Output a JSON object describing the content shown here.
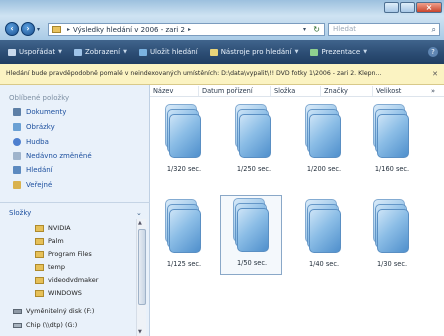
{
  "titlebar": {
    "address_path": "Výsledky hledání v 2006 - zari 2",
    "search_placeholder": "Hledat"
  },
  "toolbar": {
    "items": [
      {
        "label": "Uspořádat",
        "icon": "organize-icon",
        "color": "#c9d9ec"
      },
      {
        "label": "Zobrazení",
        "icon": "views-icon",
        "color": "#9ec3e8"
      },
      {
        "label": "Uložit hledání",
        "icon": "save-icon",
        "color": "#7ab2e0"
      },
      {
        "label": "Nástroje pro hledání",
        "icon": "search-tools-icon",
        "color": "#e8d47a"
      },
      {
        "label": "Prezentace",
        "icon": "slideshow-icon",
        "color": "#8fd08f"
      }
    ]
  },
  "infobar": {
    "text": "Hledání bude pravděpodobně pomalé v neindexovaných umístěních: D:\\data\\vypalit\\!! DVD fotky 1\\2006 - zari 2. Klepn..."
  },
  "leftpane": {
    "favorites_title": "Oblíbené položky",
    "favorites": [
      {
        "label": "Dokumenty",
        "color": "#5d7fa6"
      },
      {
        "label": "Obrázky",
        "color": "#6aa0d4"
      },
      {
        "label": "Hudba",
        "color": "#4d7fcf"
      },
      {
        "label": "Nedávno změněné",
        "color": "#9fb4cc"
      },
      {
        "label": "Hledání",
        "color": "#5c8ac0"
      },
      {
        "label": "Veřejné",
        "color": "#d9b24e"
      }
    ],
    "folders_title": "Složky",
    "folders": [
      "NVIDIA",
      "Palm",
      "Program Files",
      "temp",
      "videodvdmaker",
      "WINDOWS"
    ],
    "drives": [
      "Vyměnitelný disk (F:)",
      "Chip (\\\\dtp) (G:)"
    ]
  },
  "columns": [
    "Název",
    "Datum pořízení",
    "Složka",
    "Značky",
    "Velikost"
  ],
  "files": [
    {
      "label": "1/320 sec.",
      "selected": false
    },
    {
      "label": "1/250 sec.",
      "selected": false
    },
    {
      "label": "1/200 sec.",
      "selected": false
    },
    {
      "label": "1/160 sec.",
      "selected": false
    },
    {
      "label": "1/125 sec.",
      "selected": false
    },
    {
      "label": "1/50 sec.",
      "selected": true
    },
    {
      "label": "1/40 sec.",
      "selected": false
    },
    {
      "label": "1/30 sec.",
      "selected": false
    }
  ]
}
